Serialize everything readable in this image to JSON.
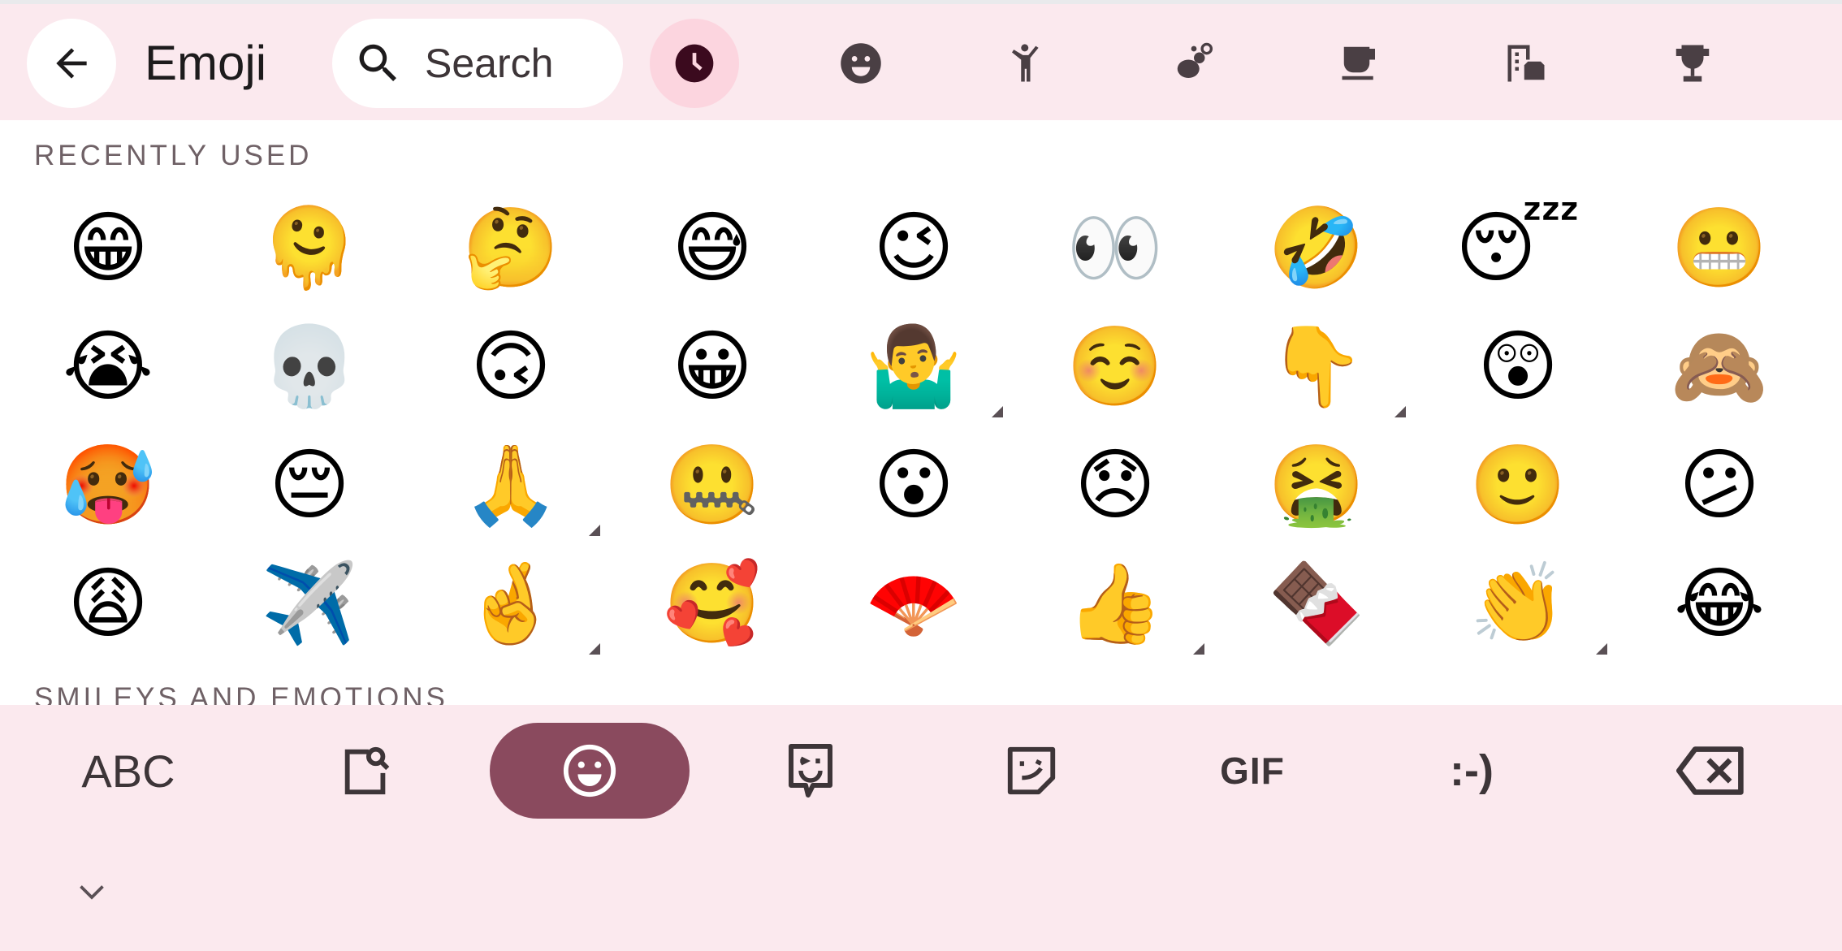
{
  "header": {
    "title": "Emoji",
    "search_placeholder": "Search",
    "categories": [
      {
        "icon": "recent-clock-icon",
        "active": true
      },
      {
        "icon": "smiley-icon"
      },
      {
        "icon": "person-icon"
      },
      {
        "icon": "animals-nature-icon"
      },
      {
        "icon": "food-drink-icon"
      },
      {
        "icon": "travel-places-icon"
      },
      {
        "icon": "activities-trophy-icon"
      }
    ]
  },
  "sections": {
    "recent_label": "RECENTLY USED",
    "next_label": "SMILEYS AND EMOTIONS"
  },
  "recent_emojis": [
    [
      "😁",
      "🫠",
      "🤔",
      "😅",
      "😉",
      "👀",
      "🤣",
      "😴",
      "😬"
    ],
    [
      "😭",
      "💀",
      "🙃",
      "😀",
      "🤷‍♂️",
      "☺️",
      "👇",
      "😲",
      "🙈"
    ],
    [
      "🥵",
      "😔",
      "🙏",
      "🤐",
      "😮",
      "😞",
      "🤮",
      "🙂",
      "😕"
    ],
    [
      "😩",
      "✈️",
      "🤞",
      "🥰",
      "🪭",
      "👍",
      "🍫",
      "👏",
      "😂"
    ]
  ],
  "skin_tone_variants": [
    [
      1,
      4
    ],
    [
      1,
      6
    ],
    [
      2,
      2
    ],
    [
      3,
      2
    ],
    [
      3,
      5
    ],
    [
      3,
      7
    ]
  ],
  "bottom_bar": {
    "abc_label": "ABC",
    "gif_label": "GIF",
    "emoticon_label": ":-)",
    "active": "emoji"
  },
  "colors": {
    "background": "#fbe9ee",
    "active_pill": "#8a4a5e",
    "recent_active_bg": "#fcd5df",
    "icon": "#4a3f44"
  }
}
